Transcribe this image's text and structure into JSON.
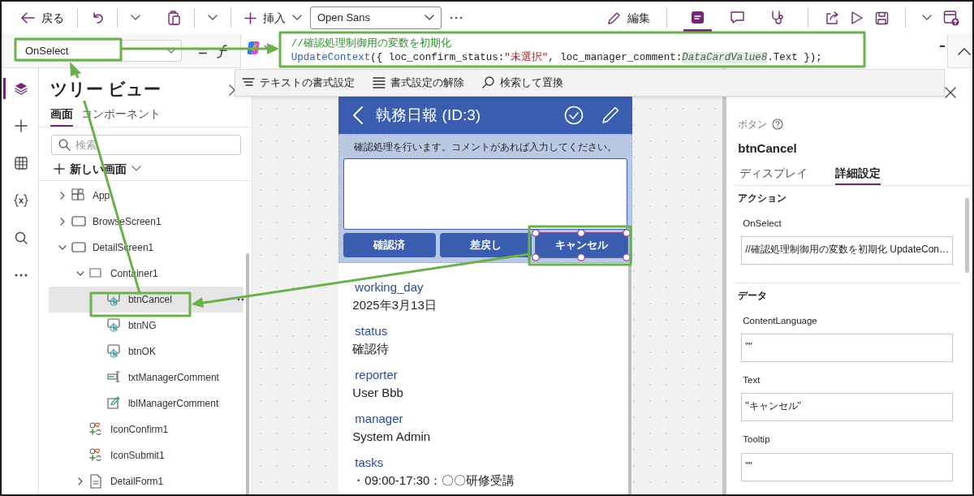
{
  "toolbar": {
    "back": "戻る",
    "insert": "挿入",
    "font": "Open Sans",
    "edit": "編集",
    "right_tabs": [
      {
        "kind": "tree",
        "selected": true
      },
      {
        "kind": "comment",
        "selected": false
      },
      {
        "kind": "checker",
        "selected": false
      }
    ]
  },
  "formula_bar": {
    "property": "OnSelect",
    "operator": "=",
    "lines": [
      [
        {
          "kind": "comment",
          "text": "//確認処理制御用の変数を初期化"
        }
      ],
      [
        {
          "kind": "function",
          "text": "UpdateContext"
        },
        {
          "kind": "plain",
          "text": "({ loc_confirm_status:"
        },
        {
          "kind": "string",
          "text": "\"未選択\""
        },
        {
          "kind": "plain",
          "text": ", loc_manager_comment:"
        },
        {
          "kind": "control",
          "text": "DataCardValue8"
        },
        {
          "kind": "plain",
          "text": ".Text });"
        }
      ]
    ]
  },
  "format_toolbar": [
    {
      "kind": "format",
      "label": "テキストの書式設定"
    },
    {
      "kind": "clear",
      "label": "書式設定の解除"
    },
    {
      "kind": "search",
      "label": "検索して置換"
    }
  ],
  "rail": [
    {
      "kind": "layers",
      "selected": true
    },
    {
      "kind": "plus",
      "selected": false
    },
    {
      "kind": "table",
      "selected": false
    },
    {
      "kind": "variables",
      "selected": false
    },
    {
      "kind": "search",
      "selected": false
    },
    {
      "kind": "more",
      "selected": false
    }
  ],
  "tree_view": {
    "title": "ツリー ビュー",
    "tabs": [
      {
        "label": "画面",
        "selected": true
      },
      {
        "label": "コンポーネント",
        "selected": false
      }
    ],
    "search": {
      "placeholder": "検索"
    },
    "new_screen": "新しい画面",
    "items": [
      {
        "label": "App",
        "kind": "app",
        "expanded": false,
        "selected": false
      },
      {
        "label": "BrowseScreen1",
        "kind": "screen",
        "expanded": false,
        "selected": false
      },
      {
        "label": "DetailScreen1",
        "kind": "screen",
        "expanded": true,
        "selected": false,
        "children": [
          {
            "label": "Container1",
            "kind": "container",
            "expanded": true,
            "selected": false,
            "children": [
              {
                "label": "btnCancel",
                "kind": "button",
                "selected": true
              },
              {
                "label": "btnNG",
                "kind": "button",
                "selected": false
              },
              {
                "label": "btnOK",
                "kind": "button",
                "selected": false
              },
              {
                "label": "txtManagerComment",
                "kind": "textinput",
                "selected": false
              },
              {
                "label": "lblManagerComment",
                "kind": "label",
                "selected": false
              }
            ]
          },
          {
            "label": "IconConfirm1",
            "kind": "icon",
            "selected": false
          },
          {
            "label": "IconSubmit1",
            "kind": "icon",
            "selected": false
          },
          {
            "label": "DetailForm1",
            "kind": "form",
            "expanded": false,
            "selected": false
          }
        ]
      }
    ]
  },
  "canvas": {
    "screen_title": "執務日報 (ID:3)",
    "prompt": "確認処理を行います。コメントがあれば入力してください。",
    "buttons": [
      {
        "label": "確認済",
        "selected": false
      },
      {
        "label": "差戻し",
        "selected": false
      },
      {
        "label": "キャンセル",
        "selected": true
      }
    ],
    "fields": [
      {
        "label": "working_day",
        "value": "2025年3月13日"
      },
      {
        "label": "status",
        "value": "確認待"
      },
      {
        "label": "reporter",
        "value": "User Bbb"
      },
      {
        "label": "manager",
        "value": "System Admin"
      },
      {
        "label": "tasks",
        "value": "・09:00-17:30：〇〇研修受講"
      }
    ]
  },
  "properties": {
    "control_type": "ボタン",
    "control_name": "btnCancel",
    "tabs": [
      {
        "label": "ディスプレイ",
        "selected": false
      },
      {
        "label": "詳細設定",
        "selected": true
      }
    ],
    "sections": [
      {
        "title": "アクション",
        "props": [
          {
            "name": "OnSelect",
            "value": "//確認処理制御用の変数を初期化 UpdateCon…"
          }
        ]
      },
      {
        "title": "データ",
        "props": [
          {
            "name": "ContentLanguage",
            "value": "\"\""
          },
          {
            "name": "Text",
            "value": "\"キャンセル\""
          },
          {
            "name": "Tooltip",
            "value": "\"\""
          }
        ]
      }
    ]
  }
}
